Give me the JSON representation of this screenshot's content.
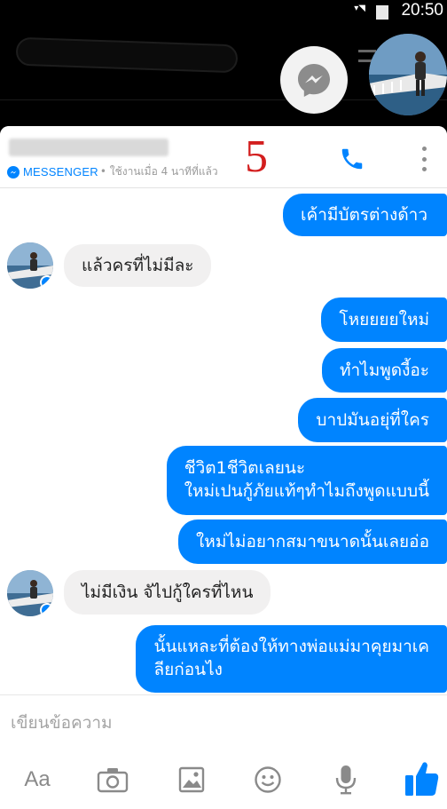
{
  "status_bar": {
    "time": "20:50"
  },
  "chat": {
    "contact_name": "",
    "brand_label": "MESSENGER",
    "last_active": "• ใช้งานเมื่อ 4 นาทีที่แล้ว",
    "annotation": "5",
    "messages": [
      {
        "direction": "out",
        "text": "เค้ามีบัตรต่างด้าว"
      },
      {
        "direction": "in",
        "text": "แล้วครที่ไม่มีละ"
      },
      {
        "direction": "out",
        "text": "โหยยยยใหม่"
      },
      {
        "direction": "out",
        "text": "ทำไมพูดงี้อะ"
      },
      {
        "direction": "out",
        "text": "บาปมันอยุ่ที่ใคร"
      },
      {
        "direction": "out",
        "lines": [
          "ชีวิต1ชีวิตเลยนะ",
          "ใหม่เปนกู้ภัยแท้ๆทำไมถึงพูดแบบนี้"
        ]
      },
      {
        "direction": "out",
        "text": "ใหม่ไม่อยากสมาขนาดนั้นเลยอ่อ"
      },
      {
        "direction": "in",
        "text": "ไม่มีเงิน จัไปกู้ใครที่ไหน"
      },
      {
        "direction": "out",
        "lines": [
          "นั้นแหละที่ต้องให้ทางพ่อแม่มาคุยมาเค",
          "ลียก่อนไง"
        ]
      }
    ]
  },
  "composer": {
    "placeholder": "เขียนข้อความ"
  },
  "toolbar": {
    "aa_label": "Aa",
    "icons": [
      "camera-icon",
      "image-icon",
      "emoji-icon",
      "mic-icon",
      "like-icon"
    ]
  },
  "colors": {
    "accent": "#0084ff",
    "incoming": "#f1f0f0",
    "annotation": "#d31e1e"
  }
}
